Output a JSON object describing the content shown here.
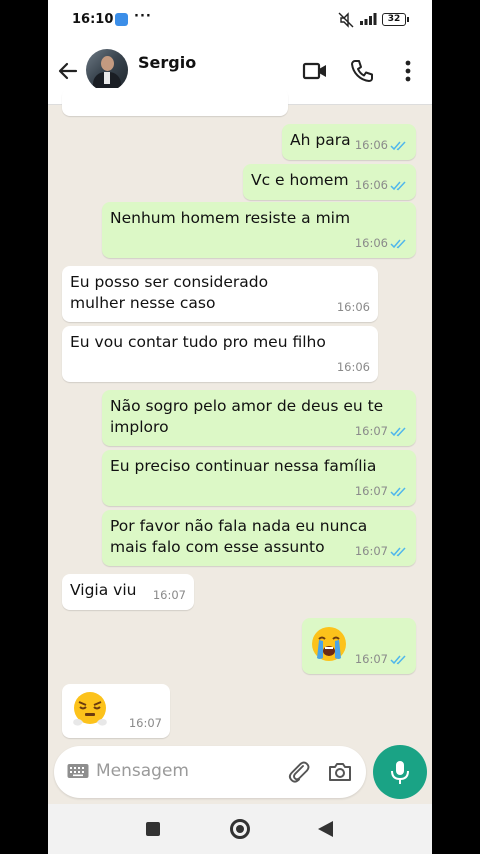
{
  "status_bar": {
    "time": "16:10",
    "dots": "···",
    "battery": "32"
  },
  "contact": {
    "name": "Sergio"
  },
  "messages": [
    {
      "dir": "in",
      "text": "",
      "time": ""
    },
    {
      "dir": "out",
      "text": "Ah para",
      "time": "16:06",
      "read": true
    },
    {
      "dir": "out",
      "text": "Vc e homem",
      "time": "16:06",
      "read": true
    },
    {
      "dir": "out",
      "text": "Nenhum homem resiste a mim",
      "time": "16:06",
      "read": true
    },
    {
      "dir": "in",
      "text": "Eu posso ser considerado mulher nesse caso",
      "time": "16:06"
    },
    {
      "dir": "in",
      "text": "Eu vou contar tudo pro meu filho",
      "time": "16:06"
    },
    {
      "dir": "out",
      "text": "Não sogro pelo amor de deus eu te imploro",
      "time": "16:07",
      "read": true
    },
    {
      "dir": "out",
      "text": "Eu preciso continuar nessa família",
      "time": "16:07",
      "read": true
    },
    {
      "dir": "out",
      "text": "Por favor não fala nada eu nunca mais falo com esse assunto",
      "time": "16:07",
      "read": true
    },
    {
      "dir": "in",
      "text": "Vigia viu",
      "time": "16:07"
    },
    {
      "dir": "out",
      "emoji": "loudly-crying-face",
      "time": "16:07",
      "read": true
    },
    {
      "dir": "in",
      "emoji": "face-with-steam-from-nose",
      "time": "16:07"
    }
  ],
  "composer": {
    "placeholder": "Mensagem"
  },
  "colors": {
    "outgoing": "#dcf8c6",
    "incoming": "#ffffff",
    "read_tick": "#4fb6ec",
    "mic": "#1aa385",
    "chat_bg": "#efeae2"
  }
}
